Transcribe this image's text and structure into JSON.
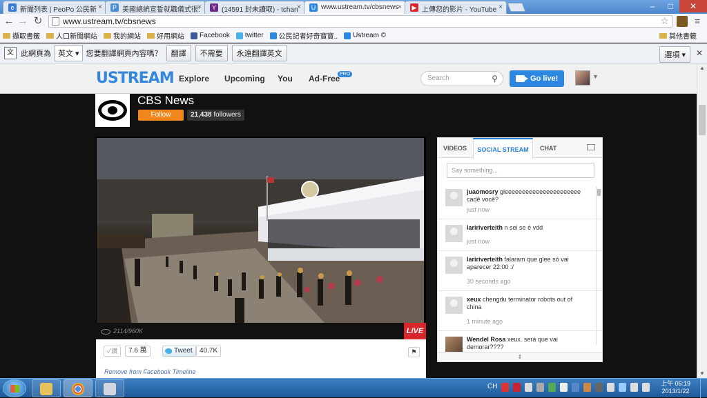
{
  "browser": {
    "tabs": [
      {
        "title": "新聞列表 | PeoPo 公民新"
      },
      {
        "title": "美國總統宣誓就職儀式很:"
      },
      {
        "title": "(14591 封未讀取) - tchan"
      },
      {
        "title": "www.ustream.tv/cbsnews"
      },
      {
        "title": "上傳您的影片 - YouTube"
      }
    ],
    "url": "www.ustream.tv/cbsnews",
    "bookmarks": [
      "擷取書籤",
      "人口新聞網站",
      "我的網站",
      "好用網站",
      "Facebook",
      "twitter",
      "公民記者好奇寶寶..",
      "Ustream ©"
    ],
    "other_bookmarks": "其他書籤",
    "translate": {
      "prefix": "此網頁為",
      "language": "英文",
      "question": "您要翻譯網頁內容嗎？",
      "translate_btn": "翻譯",
      "no_btn": "不需要",
      "always_btn": "永遠翻譯英文",
      "options_btn": "選項"
    }
  },
  "ustream": {
    "logo": "USTREAM",
    "nav": [
      "Explore",
      "Upcoming",
      "You",
      "Ad-Free"
    ],
    "pro_badge": "PRO",
    "search_placeholder": "Search",
    "go_live": "Go live!"
  },
  "channel": {
    "name": "CBS News",
    "follow_label": "Follow",
    "followers_count": "21,438",
    "followers_label": "followers"
  },
  "player": {
    "views": "2114/960K",
    "live": "LIVE"
  },
  "share": {
    "like_label": "讚",
    "like_count": "7.6 萬",
    "tweet_label": "Tweet",
    "tweet_count": "40.7K",
    "remove_fb": "Remove from Facebook Timeline"
  },
  "side": {
    "tabs": [
      "VIDEOS",
      "SOCIAL STREAM",
      "CHAT"
    ],
    "active_tab": "SOCIAL STREAM",
    "say_placeholder": "Say something...",
    "messages": [
      {
        "user": "juaomosry",
        "text": "gleeeeeeeeeeeeeeeeeeeeee cadê você?",
        "time": "just now"
      },
      {
        "user": "laririverteith",
        "text": "n sei se é vdd",
        "time": "just now"
      },
      {
        "user": "laririverteith",
        "text": "falaram que glee só vai aparecer 22:00 :/",
        "time": "30 seconds ago"
      },
      {
        "user": "xeux",
        "text": "chengdu terminator robots out of china",
        "time": "1 minute ago"
      },
      {
        "user": "Wendel Rosa",
        "text": "xeux. será que vai demorar????",
        "time": ""
      }
    ]
  },
  "taskbar": {
    "input_lang": "CH",
    "time": "上午 06:19",
    "date": "2013/1/22"
  }
}
